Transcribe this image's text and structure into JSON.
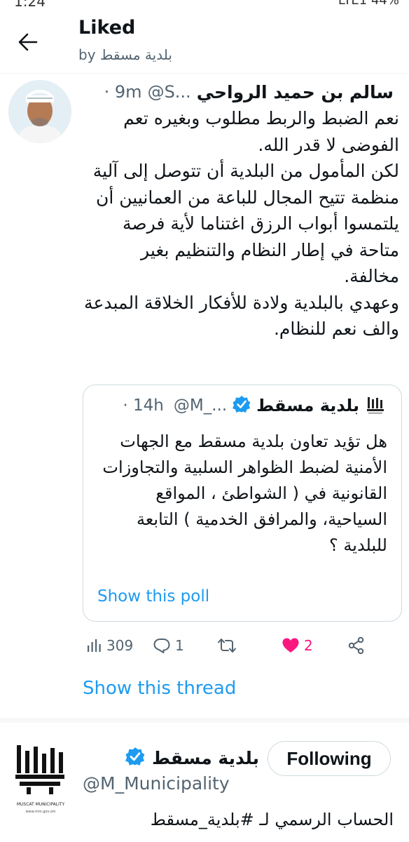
{
  "statusbar": {
    "time": "1:24",
    "indicators": "LTE1 44%"
  },
  "header": {
    "title": "Liked",
    "subtitle": "by بلدية مسقط",
    "back_icon": "arrow-left-icon"
  },
  "tweet": {
    "author_name": "سالم بن حميد الرواحي",
    "author_handle": "@S...",
    "time": "· 9m",
    "text": "نعم الضبط والربط مطلوب وبغيره تعم الفوضى لا قدر الله.\nلكن المأمول من البلدية أن تتوصل إلى آلية منظمة تتيح المجال للباعة من العمانيين أن يلتمسوا أبواب الرزق اغتناما لأية فرصة متاحة في إطار النظام والتنظيم بغير مخالفة.\nوعهدي بالبلدية ولادة للأفكار الخلاقة المبدعة والف نعم للنظام.",
    "quote": {
      "author_name": "بلدية مسقط",
      "author_handle": "@M_...",
      "time": "· 14h",
      "verified": true,
      "text": "هل تؤيد تعاون بلدية مسقط مع الجهات الأمنية لضبط الظواهر السلبية والتجاوزات القانونية في ( الشواطئ ، المواقع السياحية، والمرافق الخدمية ) التابعة للبلدية ؟",
      "show_poll": "Show this poll"
    },
    "actions": {
      "views": "309",
      "replies": "1",
      "likes": "2",
      "like_color": "#f91880"
    },
    "show_thread": "Show this thread"
  },
  "account": {
    "name": "بلدية مسقط",
    "verified": true,
    "handle": "@M_Municipality",
    "bio": "الحساب الرسمي لـ #بلدية_مسقط",
    "follow_label": "Following",
    "logo_caption": "MUSCAT MUNICIPALITY",
    "logo_url_text": "www.mm.gov.om"
  },
  "colors": {
    "accent": "#1d9bf0",
    "text": "#0f1419",
    "muted": "#536471",
    "like": "#f91880"
  }
}
